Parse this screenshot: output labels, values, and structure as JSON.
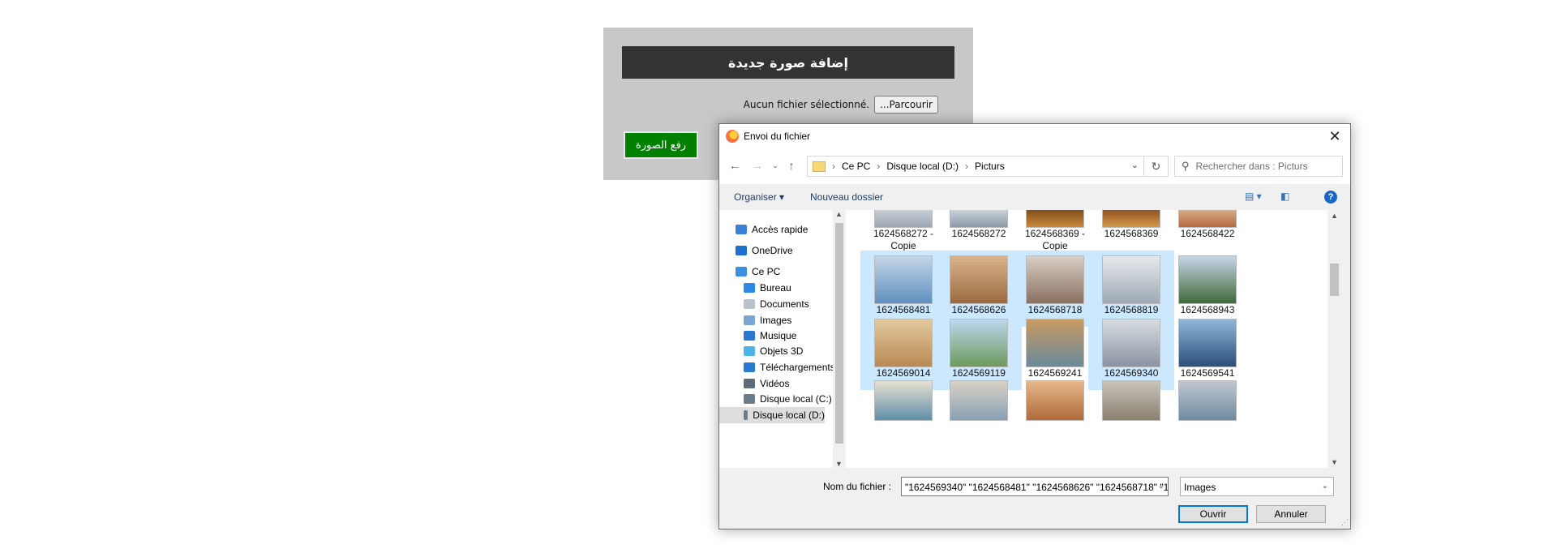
{
  "webform": {
    "title": "إضافة صورة جديدة",
    "file_status": "Aucun fichier sélectionné.",
    "browse_label": "...Parcourir",
    "upload_label": "رفع الصورة",
    "upload_color": "#008000"
  },
  "dialog": {
    "title": "Envoi du fichier",
    "close_icon": "close-icon",
    "breadcrumb": [
      "Ce PC",
      "Disque local (D:)",
      "Picturs"
    ],
    "search_placeholder": "Rechercher dans : Picturs",
    "toolbar": {
      "organize": "Organiser",
      "new_folder": "Nouveau dossier",
      "help": "?"
    },
    "nav": [
      {
        "label": "Accès rapide",
        "icon": "star-icon"
      },
      {
        "label": "OneDrive",
        "icon": "cloud-icon"
      },
      {
        "label": "Ce PC",
        "icon": "computer-icon"
      },
      {
        "label": "Bureau",
        "icon": "desktop-icon"
      },
      {
        "label": "Documents",
        "icon": "documents-icon"
      },
      {
        "label": "Images",
        "icon": "images-icon"
      },
      {
        "label": "Musique",
        "icon": "music-icon"
      },
      {
        "label": "Objets 3D",
        "icon": "cube-icon"
      },
      {
        "label": "Téléchargements",
        "icon": "download-icon"
      },
      {
        "label": "Vidéos",
        "icon": "video-icon"
      },
      {
        "label": "Disque local (C:)",
        "icon": "drive-icon"
      },
      {
        "label": "Disque local (D:)",
        "icon": "drive-icon",
        "selected": true
      }
    ],
    "files": [
      {
        "name": "1624568272 - Copie",
        "selected": false
      },
      {
        "name": "1624568272",
        "selected": false
      },
      {
        "name": "1624568369 - Copie",
        "selected": false
      },
      {
        "name": "1624568369",
        "selected": false
      },
      {
        "name": "1624568422",
        "selected": false
      },
      {
        "name": "1624568481",
        "selected": true
      },
      {
        "name": "1624568626",
        "selected": true
      },
      {
        "name": "1624568718",
        "selected": true
      },
      {
        "name": "1624568819",
        "selected": true
      },
      {
        "name": "1624568943",
        "selected": false
      },
      {
        "name": "1624569014",
        "selected": true
      },
      {
        "name": "1624569119",
        "selected": true
      },
      {
        "name": "1624569241",
        "selected": false
      },
      {
        "name": "1624569340",
        "selected": true
      },
      {
        "name": "1624569541",
        "selected": false
      },
      {
        "name": "",
        "selected": false
      },
      {
        "name": "",
        "selected": false
      },
      {
        "name": "",
        "selected": false
      },
      {
        "name": "",
        "selected": false
      },
      {
        "name": "",
        "selected": false
      }
    ],
    "filename_label": "Nom du fichier :",
    "filename_value": "\"1624569340\" \"1624568481\" \"1624568626\" \"1624568718\" \"1",
    "filetype_value": "Images",
    "open_label": "Ouvrir",
    "cancel_label": "Annuler",
    "accent_color": "#0078d7",
    "selection_color": "#cce8ff"
  }
}
